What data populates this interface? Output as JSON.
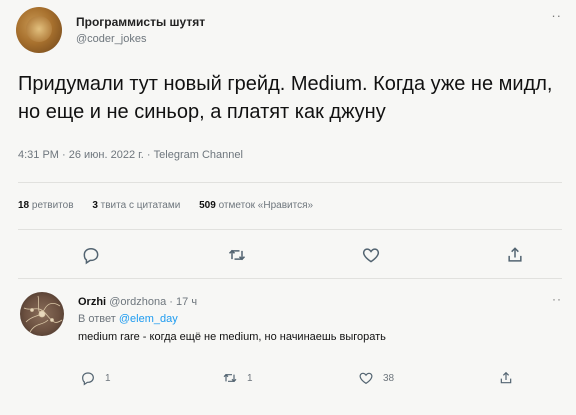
{
  "tweet": {
    "author_name": "Программисты шутят",
    "author_handle": "@coder_jokes",
    "more_label": "··",
    "text": "Придумали тут новый грейд. Medium. Когда уже не мидл, но еще и не синьор, а платят как джуну",
    "meta": "4:31 PM · 26 июн. 2022 г. · Telegram Channel",
    "stats": {
      "retweets_count": "18",
      "retweets_label": "ретвитов",
      "quotes_count": "3",
      "quotes_label": "твита с цитатами",
      "likes_count": "509",
      "likes_label": "отметок «Нравится»"
    },
    "actions": [
      "reply-icon",
      "retweet-icon",
      "like-icon",
      "share-icon"
    ]
  },
  "reply": {
    "author_name": "Orzhi",
    "author_handle": "@ordzhona",
    "separator": "·",
    "time": "17 ч",
    "more_label": "··",
    "reply_to_prefix": "В ответ",
    "reply_to_handle": "@elem_day",
    "text": "medium rare - когда ещё не medium, но начинаешь выгорать",
    "reply_count": "1",
    "retweet_count": "1",
    "like_count": "38"
  },
  "colors": {
    "link": "#1d9bf0",
    "muted": "#6e767d",
    "text": "#0f1419"
  }
}
